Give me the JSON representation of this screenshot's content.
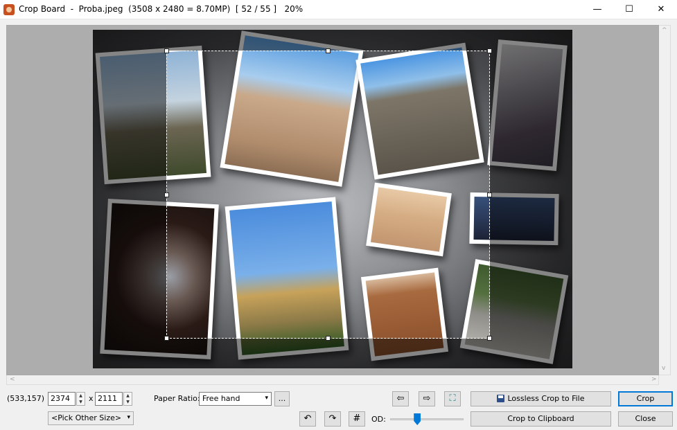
{
  "window": {
    "title": "Crop Board  -  Proba.jpeg  (3508 x 2480 = 8.70MP)  [ 52 / 55 ]   20%",
    "minimize_glyph": "—",
    "maximize_glyph": "☐",
    "close_glyph": "✕"
  },
  "status": {
    "coordinates": "(533,157)"
  },
  "size": {
    "width": "2374",
    "times": "x",
    "height": "2111",
    "pick_other": "<Pick Other Size>"
  },
  "paper_ratio": {
    "label": "Paper Ratio:",
    "value": "Free hand",
    "more": "..."
  },
  "toolbar": {
    "prev_glyph": "⇦",
    "next_glyph": "⇨",
    "fit_glyph": "⛶",
    "rotate_left_glyph": "↶",
    "rotate_right_glyph": "↷",
    "grid_glyph": "#",
    "od_label": "OD:"
  },
  "od_slider": {
    "value_fraction": 0.37
  },
  "buttons": {
    "lossless": "Lossless Crop to File",
    "clipboard": "Crop to Clipboard",
    "crop": "Crop",
    "close": "Close"
  },
  "scroll": {
    "left": "<",
    "right": ">",
    "up": "^",
    "down": "v"
  },
  "colors": {
    "accent": "#0078d7",
    "viewport_bg": "#adadad"
  },
  "icons": [
    "app-icon",
    "save-disk-icon",
    "arrow-left-icon",
    "arrow-right-icon",
    "fit-icon",
    "rotate-left-icon",
    "rotate-right-icon",
    "grid-icon"
  ]
}
